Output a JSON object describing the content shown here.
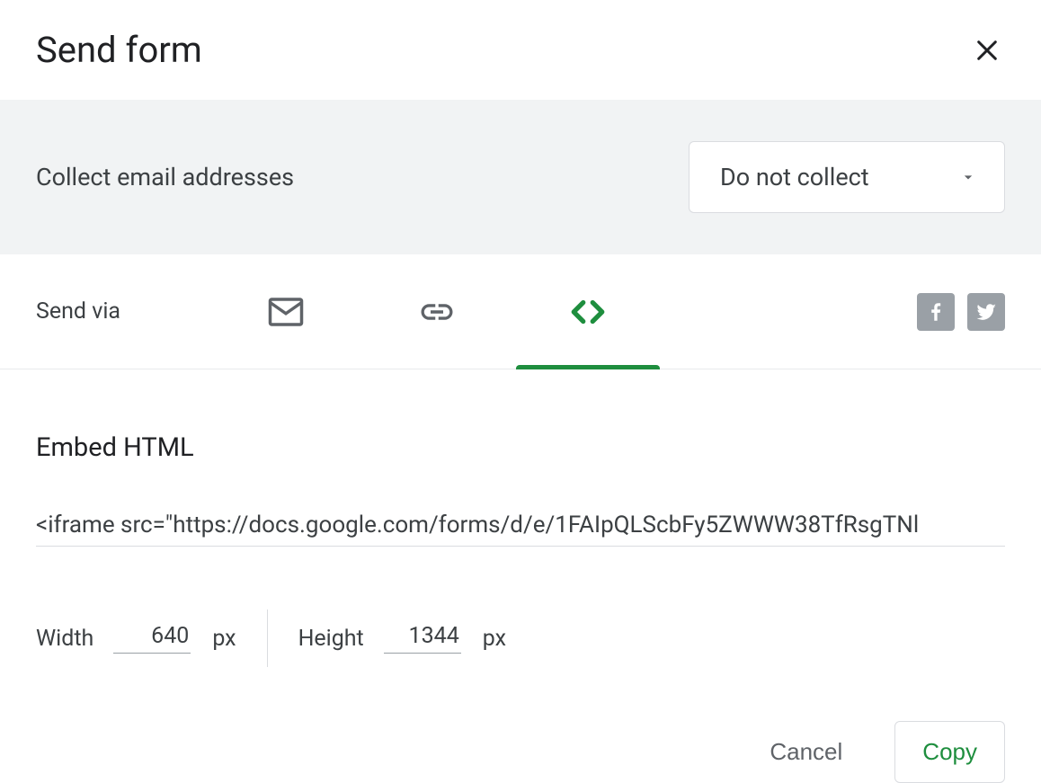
{
  "header": {
    "title": "Send form"
  },
  "collect": {
    "label": "Collect email addresses",
    "dropdown_value": "Do not collect"
  },
  "tabs": {
    "send_via_label": "Send via"
  },
  "embed": {
    "heading": "Embed HTML",
    "code": "<iframe src=\"https://docs.google.com/forms/d/e/1FAIpQLScbFy5ZWWW38TfRsgTNl",
    "width_label": "Width",
    "width_value": "640",
    "width_unit": "px",
    "height_label": "Height",
    "height_value": "1344",
    "height_unit": "px"
  },
  "footer": {
    "cancel_label": "Cancel",
    "copy_label": "Copy"
  }
}
